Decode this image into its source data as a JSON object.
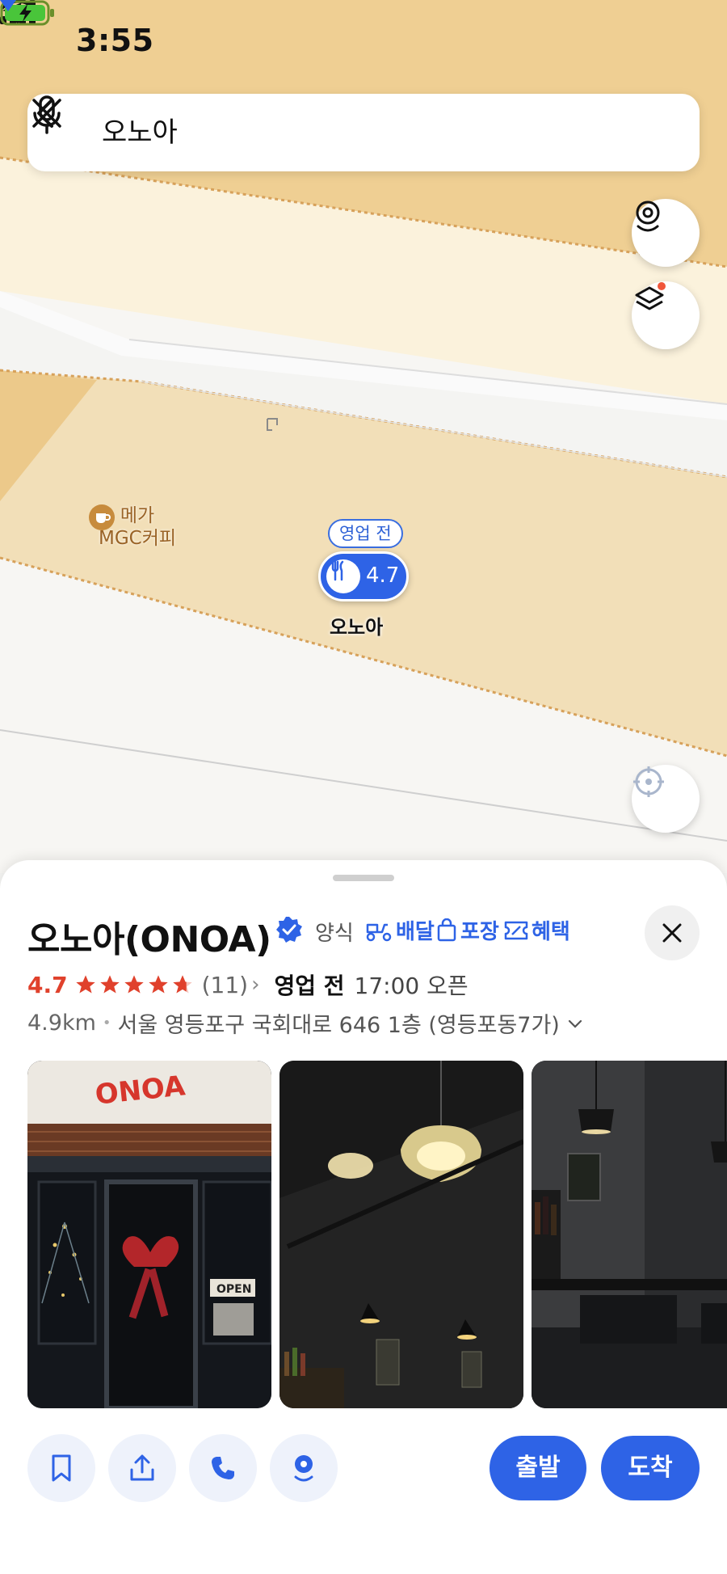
{
  "status_bar": {
    "time": "3:55"
  },
  "search": {
    "query": "오노아"
  },
  "map": {
    "poi_cafe": {
      "name_line1": "메가",
      "name_line2": "MGC커피"
    },
    "selected_pin": {
      "badge": "영업 전",
      "rating": "4.7",
      "name": "오노아"
    },
    "colors": {
      "land": "#f2dfb8",
      "road": "#fbfbfb",
      "accent": "#2e63e6"
    }
  },
  "place": {
    "name": "오노아(ONOA)",
    "category": "양식",
    "services": {
      "delivery": "배달",
      "takeout": "포장",
      "benefit": "혜택"
    },
    "rating": "4.7",
    "stars": 4.7,
    "review_count": "(11)",
    "open_status": "영업 전",
    "hours": "17:00 오픈",
    "distance": "4.9km",
    "address": "서울 영등포구 국회대로 646 1층 (영등포동7가)",
    "photos": [
      {
        "sign_text": "ONOA",
        "door_sign": "OPEN"
      },
      {
        "subject": "pendant-lamp"
      },
      {
        "subject": "dining-room"
      }
    ]
  },
  "actions": {
    "depart": "출발",
    "arrive": "도착"
  }
}
